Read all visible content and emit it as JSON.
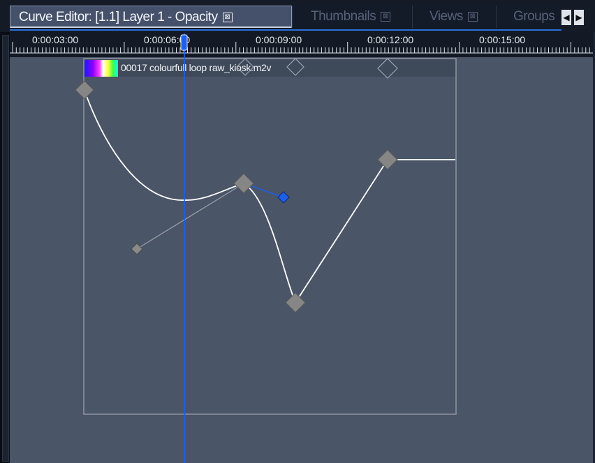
{
  "tabs": [
    {
      "label": "Curve Editor: [1.1] Layer 1 - Opacity",
      "active": true
    },
    {
      "label": "Thumbnails",
      "active": false
    },
    {
      "label": "Views",
      "active": false
    },
    {
      "label": "Groups",
      "active": false
    }
  ],
  "tab_close_glyph": "⊠",
  "nav": {
    "prev": "◀",
    "next": "▶"
  },
  "ruler": {
    "labels": [
      "0:00:03:00",
      "0:00:06:00",
      "0:00:09:00",
      "0:00:12:00",
      "0:00:15:00"
    ]
  },
  "clip": {
    "name": "00017 colourfull loop raw_kiosk.m2v"
  },
  "colors": {
    "accent": "#2a6fd8",
    "selected_handle": "#1f5fe8",
    "keyframe": "#888888",
    "curve": "#ffffff",
    "background": "#4a5567"
  }
}
